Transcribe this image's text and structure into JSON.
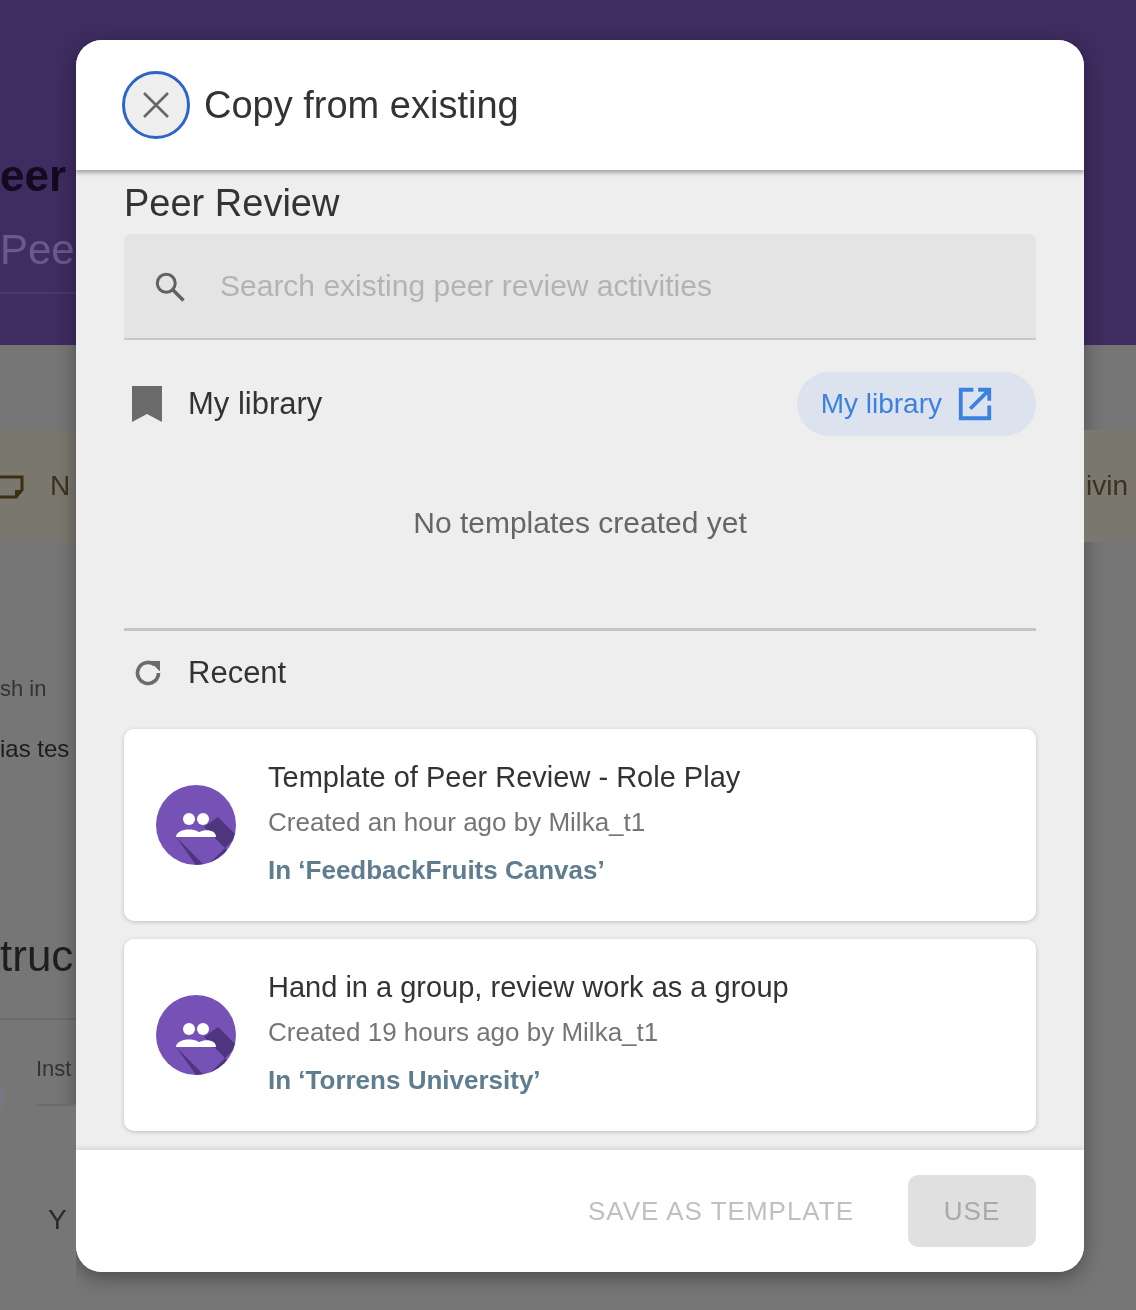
{
  "background": {
    "header_title": "eer",
    "header_subtitle": "Pee",
    "banner_left": "N",
    "banner_right": "ivin",
    "row_label": "sh in",
    "row_value": "ias tes",
    "section_heading": "truc",
    "field_label": "Inst",
    "field_value": "Y"
  },
  "dialog": {
    "title": "Copy from existing",
    "section_title": "Peer Review",
    "search": {
      "placeholder": "Search existing peer review activities"
    },
    "library": {
      "heading": "My library",
      "button": "My library",
      "empty": "No templates created yet"
    },
    "recent": {
      "heading": "Recent",
      "items": [
        {
          "title": "Template of Peer Review - Role Play",
          "meta": "Created an hour ago by Milka_t1",
          "course": "In ‘FeedbackFruits Canvas’"
        },
        {
          "title": "Hand in a group, review work as a group",
          "meta": "Created 19 hours ago by Milka_t1",
          "course": "In ‘Torrens University’"
        }
      ]
    },
    "footer": {
      "buttons": [
        {
          "label": "SAVE AS TEMPLATE",
          "kind": "text",
          "disabled": true
        },
        {
          "label": "USE",
          "kind": "filled",
          "disabled": true
        }
      ]
    }
  }
}
